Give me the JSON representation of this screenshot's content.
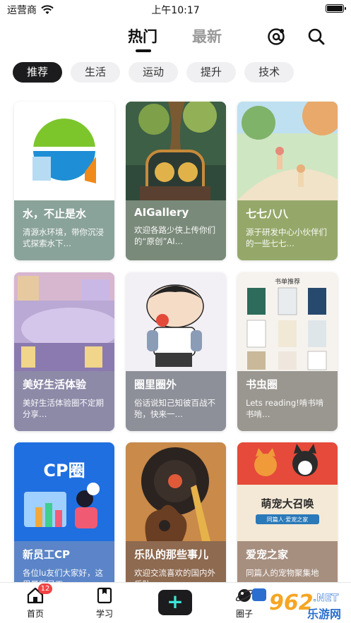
{
  "status_bar": {
    "carrier": "运营商",
    "time": "上午10:17"
  },
  "header": {
    "tabs": [
      {
        "label": "热门",
        "active": true
      },
      {
        "label": "最新",
        "active": false
      }
    ]
  },
  "categories": [
    {
      "label": "推荐",
      "active": true
    },
    {
      "label": "生活"
    },
    {
      "label": "运动"
    },
    {
      "label": "提升"
    },
    {
      "label": "技术"
    }
  ],
  "cards": [
    {
      "title": "水，不止是水",
      "desc": "清源水环境，带你沉浸式探索水下…",
      "cover": "water-logo",
      "overlay": "#8aa39a"
    },
    {
      "title": "AIGallery",
      "desc": "欢迎各路少侠上传你们的“原创”AI…",
      "cover": "ai-machine",
      "overlay": "#7a8a7a"
    },
    {
      "title": "七七八八",
      "desc": "源于研发中心小伙伴们的一些七七…",
      "cover": "park-painting",
      "overlay": "#95a86a"
    },
    {
      "title": "美好生活体验",
      "desc": "美好生活体验圈不定期分享…",
      "cover": "town-plaza",
      "overlay": "#8d8aa8"
    },
    {
      "title": "圈里圈外",
      "desc": "俗话说知己知彼百战不殆，快来一…",
      "cover": "cartoon-boy",
      "overlay": "#8e9099"
    },
    {
      "title": "书虫圈",
      "desc": "Lets reading!啃书啃书啃…",
      "cover": "book-shelf",
      "overlay": "#9a9790"
    },
    {
      "title": "新员工CP",
      "desc": "各位lu友们大家好，这里是新员工…",
      "cover": "cp-poster",
      "overlay": "#5b85c8"
    },
    {
      "title": "乐队的那些事儿",
      "desc": "欢迎交流喜欢的国内外乐队",
      "cover": "vinyl-guitar",
      "overlay": "#8e6a50"
    },
    {
      "title": "爱宠之家",
      "desc": "同篇人的宠物聚集地",
      "cover": "pet-poster",
      "overlay": "#a78f7f"
    }
  ],
  "cover_text": {
    "cp_title": "CP圈",
    "pet_title": "萌宠大召唤",
    "pet_sub": "同篇人·爱宠之家",
    "book_header": "书单推荐"
  },
  "bottom_nav": {
    "home_label": "首页",
    "home_badge": "12",
    "study_label": "学习",
    "add_label": "+",
    "circle_label": "圈子",
    "watermark_main": "962",
    "watermark_net": ".NET",
    "watermark_sub": "乐游网"
  }
}
